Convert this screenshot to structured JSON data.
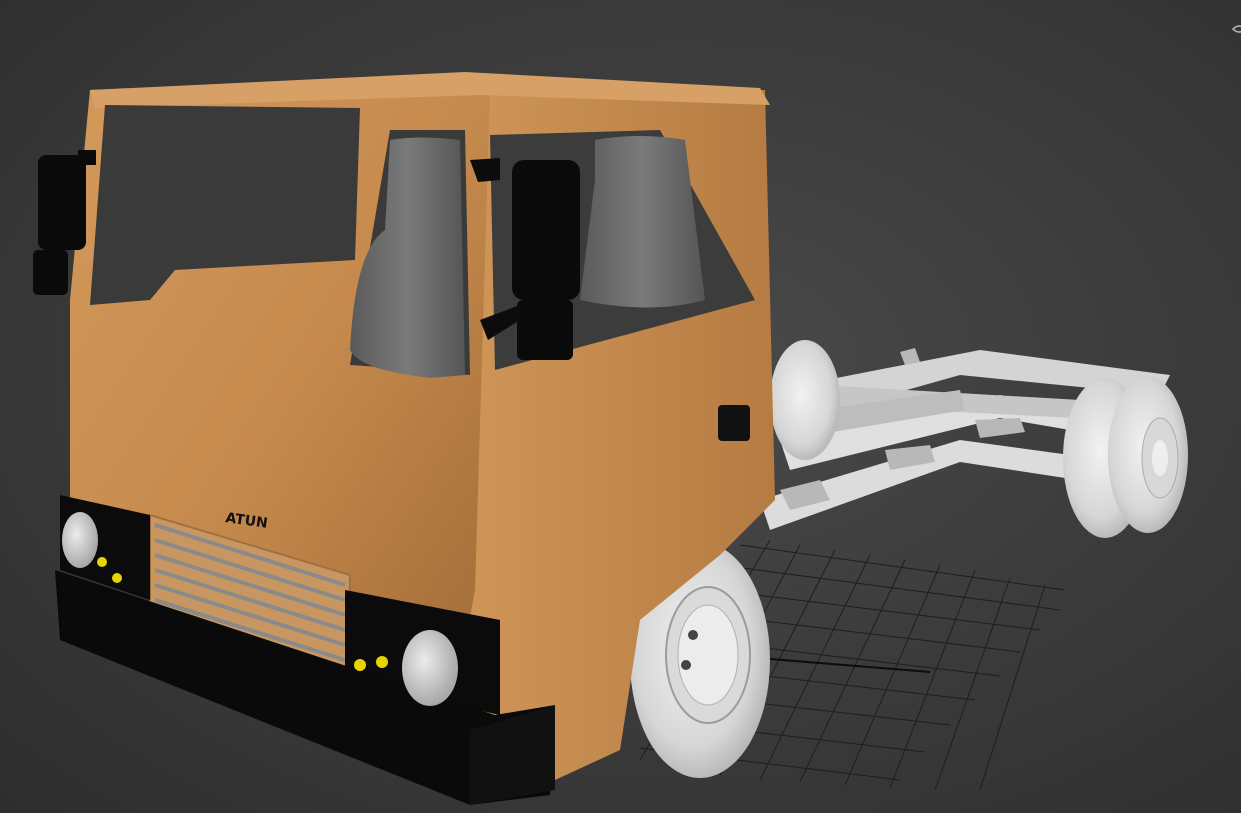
{
  "viewport": {
    "name": "3d-perspective-viewport",
    "background_color": "#3d3d3d",
    "grid_color": "#1c1c1c"
  },
  "model": {
    "cab_color": "#c98d4f",
    "cab_shadow_color": "#a86f38",
    "seat_color": "#6e6e6e",
    "trim_color": "#0b0b0b",
    "chassis_color": "#d9d9d9",
    "headlight_color": "#d0d0d0",
    "indicator_color": "#e8d400",
    "badge_text": "ATUN"
  },
  "icons": {
    "viewcube": "viewcube-icon"
  }
}
